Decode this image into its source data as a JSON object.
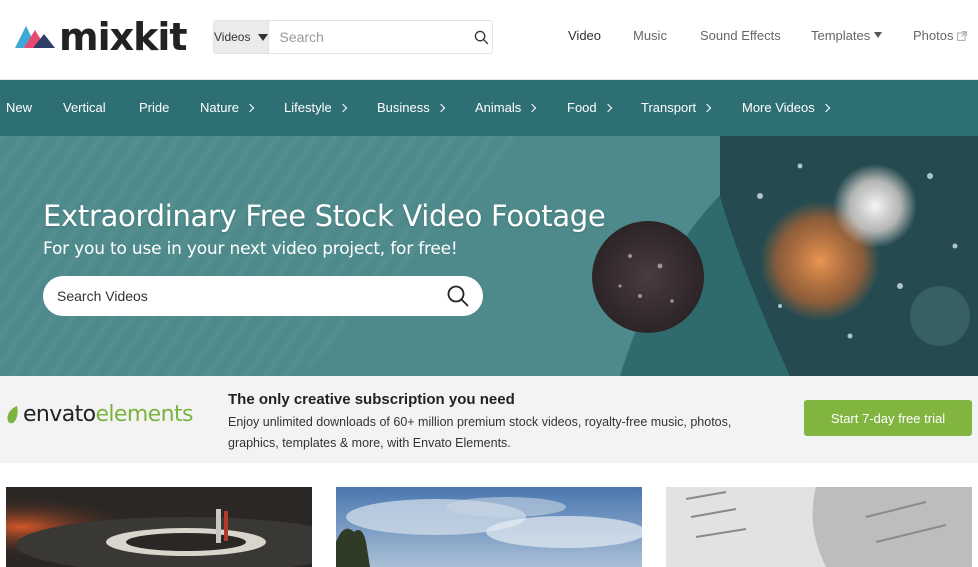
{
  "brand": {
    "logo_text": "mixkit"
  },
  "search": {
    "category": "Videos",
    "placeholder": "Search"
  },
  "top_nav": {
    "items": [
      "Video",
      "Music",
      "Sound Effects",
      "Templates",
      "Photos"
    ]
  },
  "categories": [
    "New",
    "Vertical",
    "Pride",
    "Nature",
    "Lifestyle",
    "Business",
    "Animals",
    "Food",
    "Transport",
    "More Videos"
  ],
  "hero": {
    "title": "Extraordinary Free Stock Video Footage",
    "subtitle": "For you to use in your next video project, for free!",
    "search_placeholder": "Search Videos"
  },
  "envato": {
    "logo_envato": "envato",
    "logo_elements": "elements",
    "title": "The only creative subscription you need",
    "description": "Enjoy unlimited downloads of 60+ million premium stock videos, royalty-free music, photos, graphics, templates & more, with Envato Elements.",
    "cta": "Start 7-day free trial"
  },
  "colors": {
    "category_bar": "#2e6f73",
    "hero_bg": "#4e8a8b",
    "cta_green": "#82b440"
  }
}
